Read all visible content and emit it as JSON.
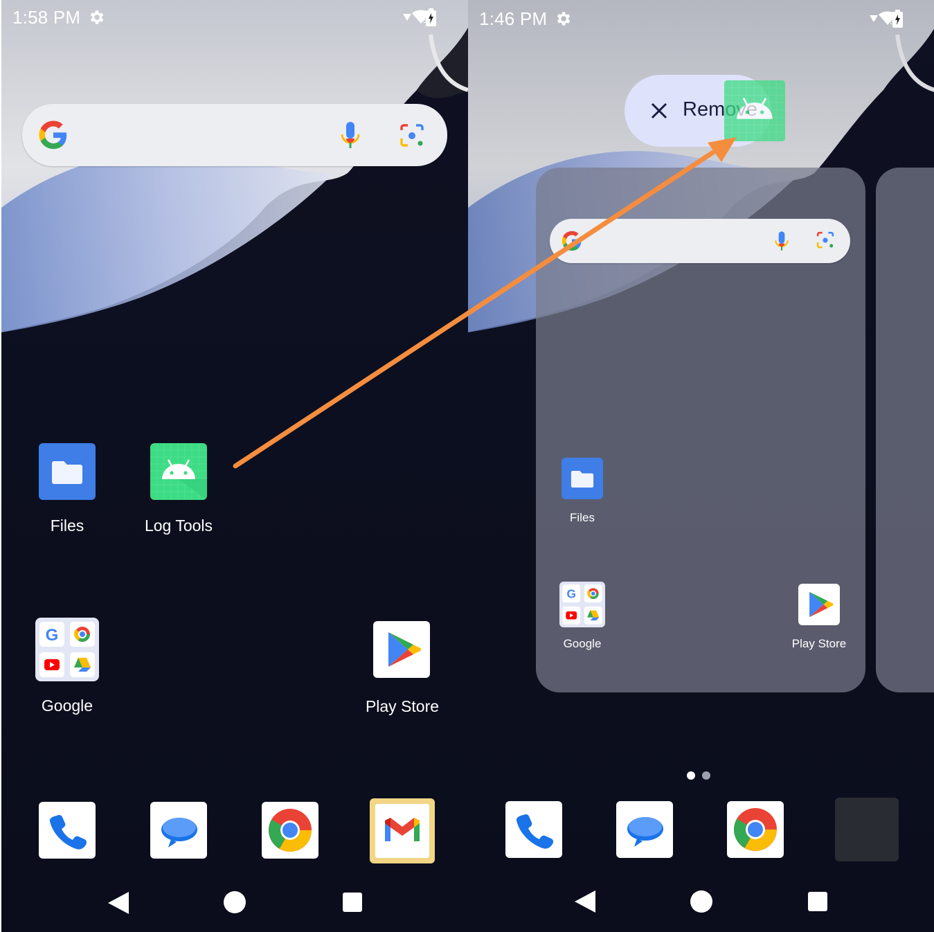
{
  "left_screen": {
    "status": {
      "time": "1:58 PM"
    },
    "apps": {
      "files": "Files",
      "log_tools": "Log Tools",
      "google_folder": "Google",
      "play_store": "Play Store"
    }
  },
  "right_screen": {
    "status": {
      "time": "1:46 PM"
    },
    "remove_label": "Remove",
    "apps": {
      "files": "Files",
      "google_folder": "Google",
      "play_store": "Play Store"
    },
    "page_indicator": {
      "pages": 2,
      "current": 1
    }
  },
  "colors": {
    "annotation_arrow": "#f58d3f",
    "search_bar": "#eceef2",
    "remove_pill": "#dfe2fb",
    "files_blue": "#3f7de7",
    "log_tools_green": "#3ddc84",
    "gmail_dock_bg": "#f2d686"
  },
  "icons": [
    "gear-icon",
    "signal-icon",
    "wifi-icon",
    "battery-icon",
    "google-g-icon",
    "mic-icon",
    "lens-icon",
    "files-icon",
    "android-icon",
    "google-folder-icon",
    "play-store-icon",
    "phone-icon",
    "messages-icon",
    "chrome-icon",
    "gmail-icon",
    "back-icon",
    "home-icon",
    "recents-icon",
    "close-icon"
  ]
}
